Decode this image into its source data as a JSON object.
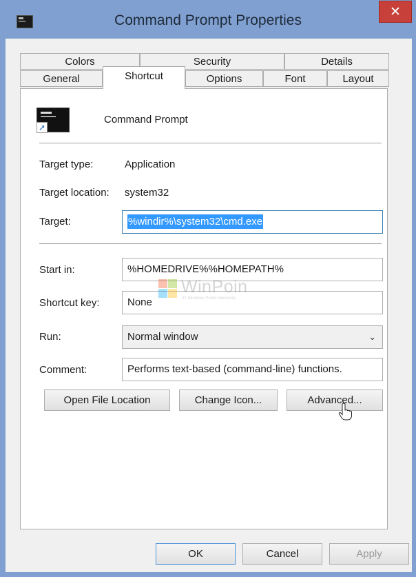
{
  "window": {
    "title": "Command Prompt Properties",
    "close_glyph": "✕"
  },
  "tabs_row1": [
    "Colors",
    "Security",
    "Details"
  ],
  "tabs_row2": [
    "General",
    "Shortcut",
    "Options",
    "Font",
    "Layout"
  ],
  "selected_tab": "Shortcut",
  "shortcut": {
    "name": "Command Prompt",
    "icon": "command-prompt-icon",
    "target_type_label": "Target type:",
    "target_type_value": "Application",
    "target_location_label": "Target location:",
    "target_location_value": "system32",
    "target_label": "Target:",
    "target_value": "%windir%\\system32\\cmd.exe",
    "start_in_label": "Start in:",
    "start_in_value": "%HOMEDRIVE%%HOMEPATH%",
    "shortcut_key_label": "Shortcut key:",
    "shortcut_key_value": "None",
    "run_label": "Run:",
    "run_value": "Normal window",
    "comment_label": "Comment:",
    "comment_value": "Performs text-based (command-line) functions."
  },
  "buttons": {
    "open_file_location": "Open File Location",
    "change_icon": "Change Icon...",
    "advanced": "Advanced...",
    "ok": "OK",
    "cancel": "Cancel",
    "apply": "Apply"
  },
  "watermark": {
    "text": "WinPoin",
    "sub": "#1 Windows Portal Indonesia"
  },
  "colors": {
    "frame": "#7fa0d0",
    "close": "#c7413a",
    "selection": "#3399ff",
    "focus_border": "#3c7fb1"
  }
}
